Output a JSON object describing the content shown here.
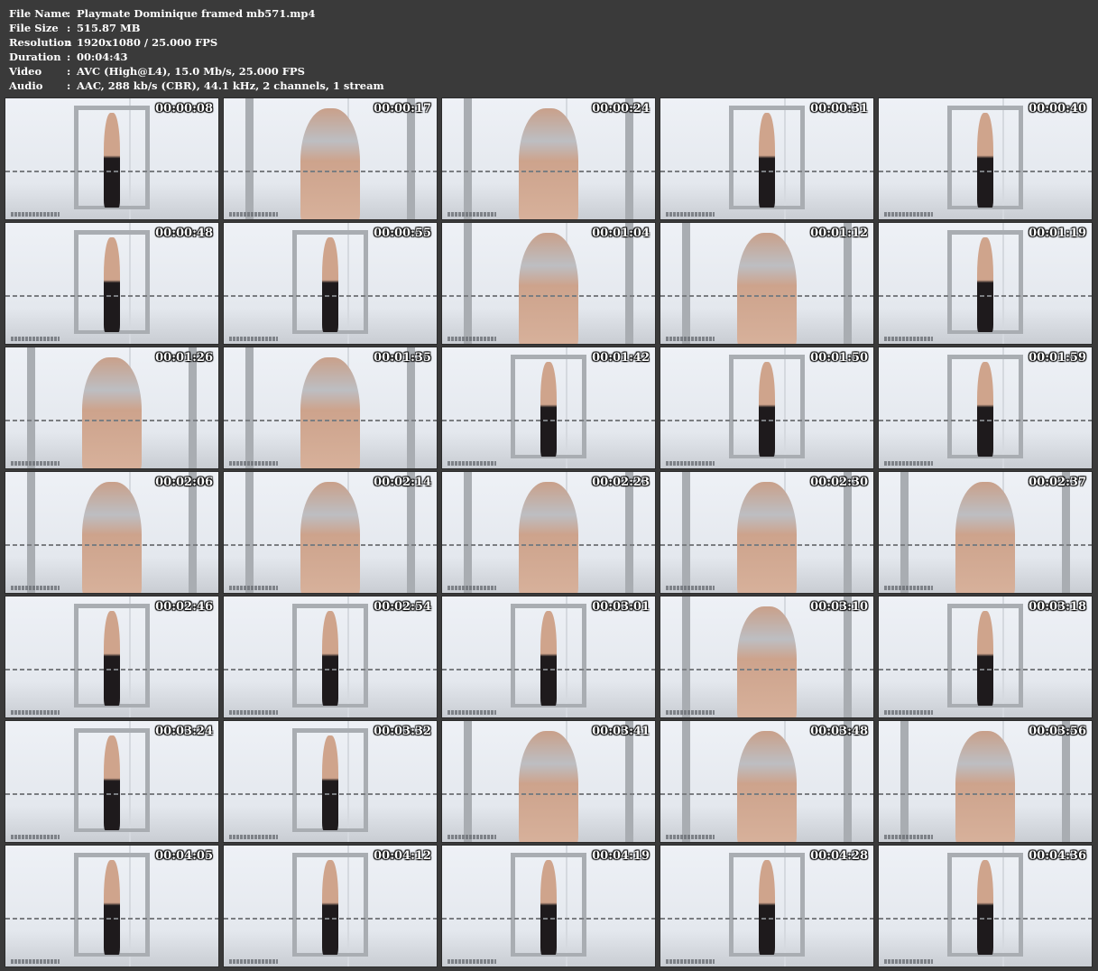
{
  "info": {
    "file_name_label": "File Name",
    "file_name": "Playmate Dominique framed mb571.mp4",
    "file_size_label": "File Size",
    "file_size": "515.87 MB",
    "resolution_label": "Resolution",
    "resolution": "1920x1080 / 25.000 FPS",
    "duration_label": "Duration",
    "duration": "00:04:43",
    "video_label": "Video",
    "video": "AVC (High@L4), 15.0 Mb/s, 25.000 FPS",
    "audio_label": "Audio",
    "audio": "AAC, 288 kb/s (CBR), 44.1 kHz, 2 channels, 1 stream",
    "colon": ":"
  },
  "thumbnails": [
    {
      "timestamp": "00:00:08",
      "shot": "wide"
    },
    {
      "timestamp": "00:00:17",
      "shot": "close"
    },
    {
      "timestamp": "00:00:24",
      "shot": "close"
    },
    {
      "timestamp": "00:00:31",
      "shot": "medium"
    },
    {
      "timestamp": "00:00:40",
      "shot": "wide"
    },
    {
      "timestamp": "00:00:48",
      "shot": "wide"
    },
    {
      "timestamp": "00:00:55",
      "shot": "wide"
    },
    {
      "timestamp": "00:01:04",
      "shot": "close"
    },
    {
      "timestamp": "00:01:12",
      "shot": "close"
    },
    {
      "timestamp": "00:01:19",
      "shot": "medium"
    },
    {
      "timestamp": "00:01:26",
      "shot": "close"
    },
    {
      "timestamp": "00:01:35",
      "shot": "close"
    },
    {
      "timestamp": "00:01:42",
      "shot": "wide"
    },
    {
      "timestamp": "00:01:50",
      "shot": "wide"
    },
    {
      "timestamp": "00:01:59",
      "shot": "wide"
    },
    {
      "timestamp": "00:02:06",
      "shot": "close"
    },
    {
      "timestamp": "00:02:14",
      "shot": "close"
    },
    {
      "timestamp": "00:02:23",
      "shot": "close"
    },
    {
      "timestamp": "00:02:30",
      "shot": "close"
    },
    {
      "timestamp": "00:02:37",
      "shot": "close"
    },
    {
      "timestamp": "00:02:46",
      "shot": "medium"
    },
    {
      "timestamp": "00:02:54",
      "shot": "wide"
    },
    {
      "timestamp": "00:03:01",
      "shot": "wide"
    },
    {
      "timestamp": "00:03:10",
      "shot": "close"
    },
    {
      "timestamp": "00:03:18",
      "shot": "medium"
    },
    {
      "timestamp": "00:03:24",
      "shot": "wide"
    },
    {
      "timestamp": "00:03:32",
      "shot": "wide"
    },
    {
      "timestamp": "00:03:41",
      "shot": "close"
    },
    {
      "timestamp": "00:03:48",
      "shot": "close"
    },
    {
      "timestamp": "00:03:56",
      "shot": "close"
    },
    {
      "timestamp": "00:04:05",
      "shot": "medium"
    },
    {
      "timestamp": "00:04:12",
      "shot": "wide"
    },
    {
      "timestamp": "00:04:19",
      "shot": "wide"
    },
    {
      "timestamp": "00:04:28",
      "shot": "wide"
    },
    {
      "timestamp": "00:04:36",
      "shot": "wide"
    }
  ]
}
